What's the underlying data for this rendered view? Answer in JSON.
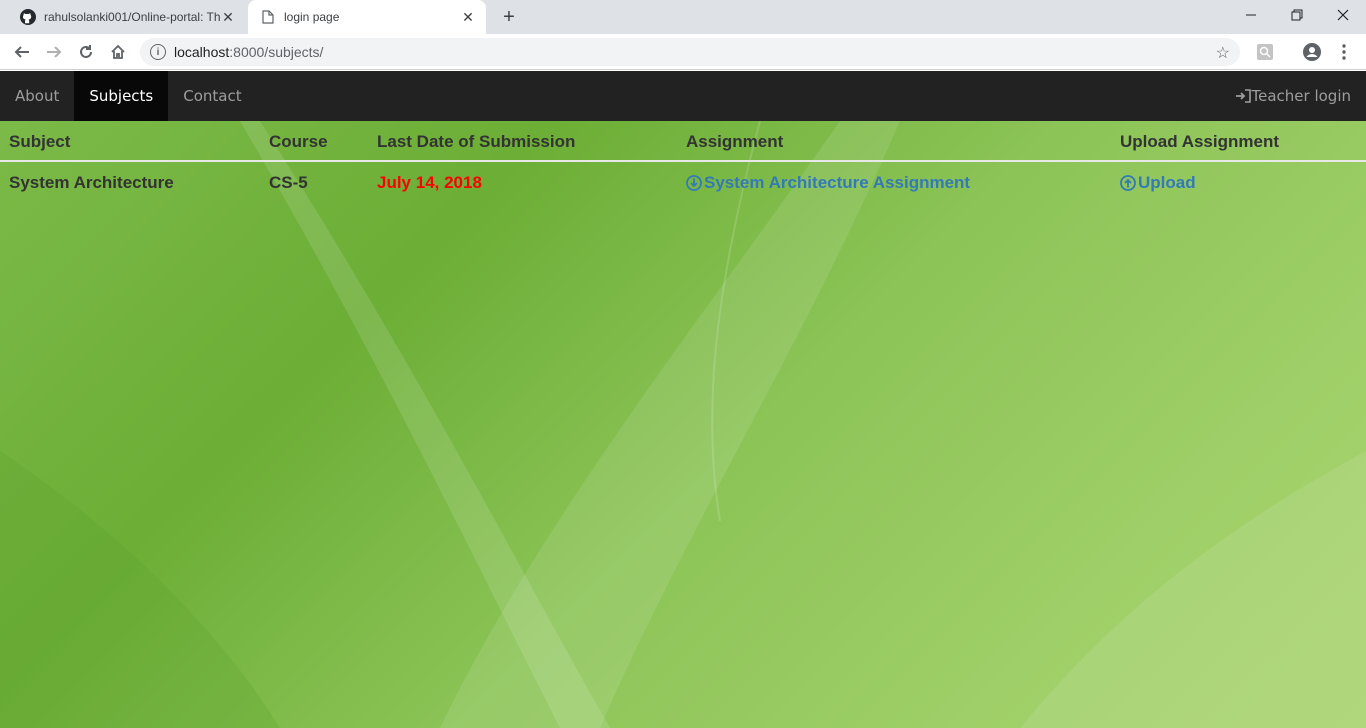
{
  "browser": {
    "tabs": [
      {
        "title": "rahulsolanki001/Online-portal: Th",
        "icon": "github-icon",
        "active": false
      },
      {
        "title": "login page",
        "icon": "page-icon",
        "active": true
      }
    ],
    "url_host": "localhost",
    "url_rest": ":8000/subjects/"
  },
  "navbar": {
    "items": [
      {
        "label": "About",
        "active": false
      },
      {
        "label": "Subjects",
        "active": true
      },
      {
        "label": "Contact",
        "active": false
      }
    ],
    "login_label": "Teacher login"
  },
  "table": {
    "headers": [
      "Subject",
      "Course",
      "Last Date of Submission",
      "Assignment",
      "Upload Assignment"
    ],
    "rows": [
      {
        "subject": "System Architecture",
        "course": "CS-5",
        "last_date": "July 14, 2018",
        "assignment": "System Architecture Assignment",
        "upload": "Upload"
      }
    ]
  },
  "colors": {
    "navbar_bg": "#222222",
    "date": "#ff0000",
    "link": "#337ab7"
  }
}
